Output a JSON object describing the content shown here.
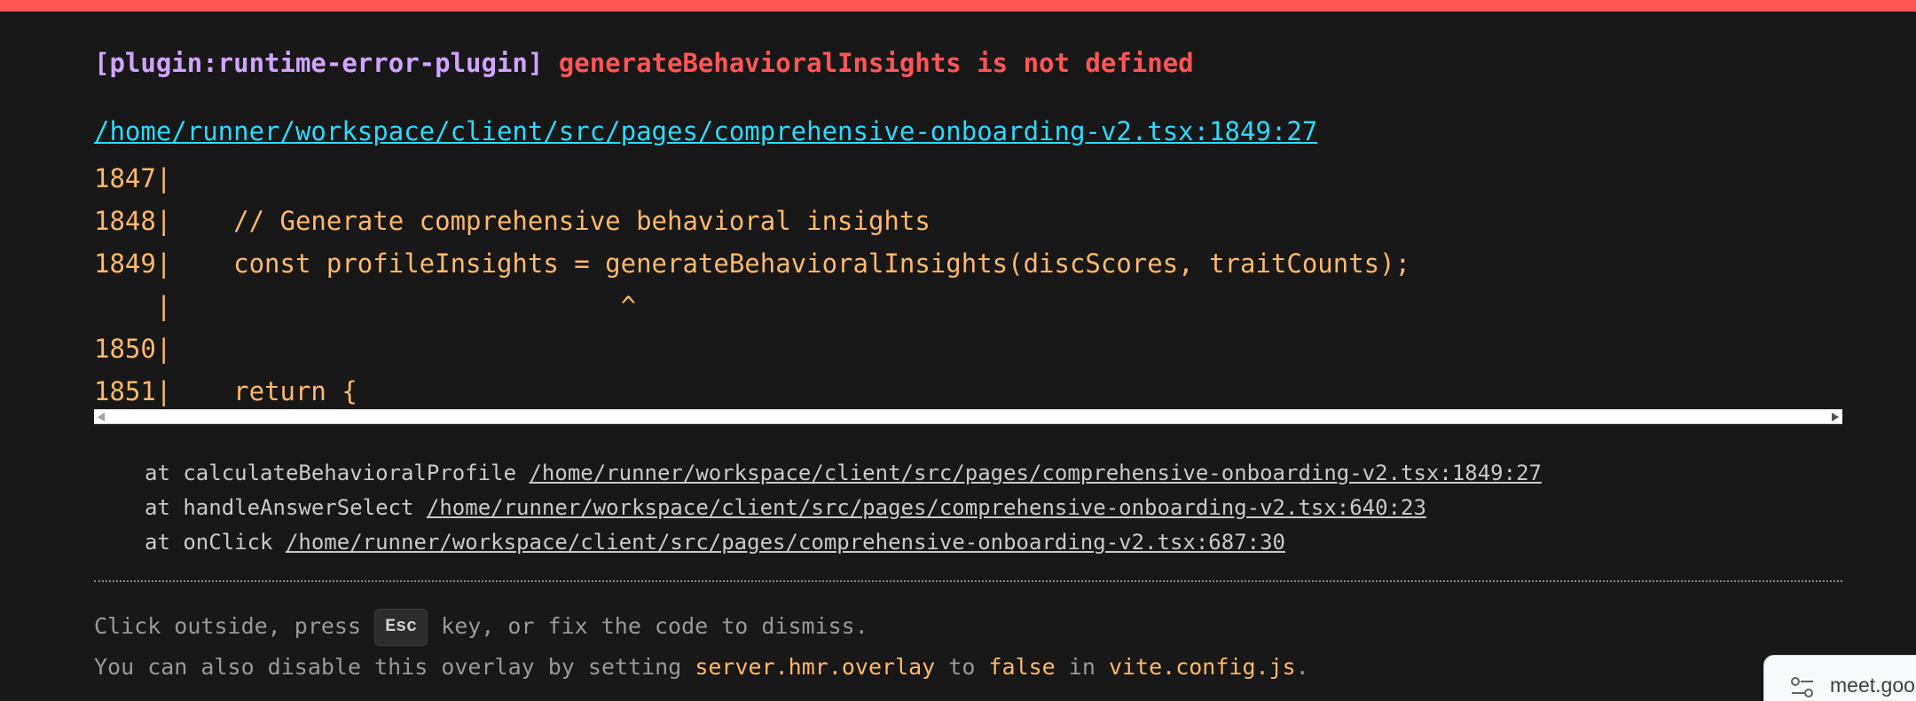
{
  "error": {
    "plugin": "[plugin:runtime-error-plugin]",
    "message": "generateBehavioralInsights is not defined",
    "file": "/home/runner/workspace/client/src/pages/comprehensive-onboarding-v2.tsx:1849:27"
  },
  "code_frame": [
    "1847|",
    "1848|    // Generate comprehensive behavioral insights",
    "1849|    const profileInsights = generateBehavioralInsights(discScores, traitCounts);",
    "    |                             ^",
    "1850|",
    "1851|    return {"
  ],
  "stack": [
    {
      "prefix": "at calculateBehavioralProfile ",
      "link": "/home/runner/workspace/client/src/pages/comprehensive-onboarding-v2.tsx:1849:27"
    },
    {
      "prefix": "at handleAnswerSelect ",
      "link": "/home/runner/workspace/client/src/pages/comprehensive-onboarding-v2.tsx:640:23"
    },
    {
      "prefix": "at onClick ",
      "link": "/home/runner/workspace/client/src/pages/comprehensive-onboarding-v2.tsx:687:30"
    }
  ],
  "tip": {
    "line1_pre": "Click outside, press ",
    "key": "Esc",
    "line1_post": " key, or fix the code to dismiss.",
    "line2_a": "You can also disable this overlay by setting ",
    "line2_b": "server.hmr.overlay",
    "line2_c": " to ",
    "line2_d": "false",
    "line2_e": " in ",
    "line2_f": "vite.config.js",
    "line2_g": "."
  },
  "meet_chip": {
    "label": "meet.goo",
    "icon": "sliders-icon"
  },
  "colors": {
    "top_bar": "#ff5555",
    "background": "#181818",
    "plugin": "#cfa4ff",
    "error": "#ff5555",
    "file_link": "#2dd9fe",
    "code": "#ffb86c"
  }
}
